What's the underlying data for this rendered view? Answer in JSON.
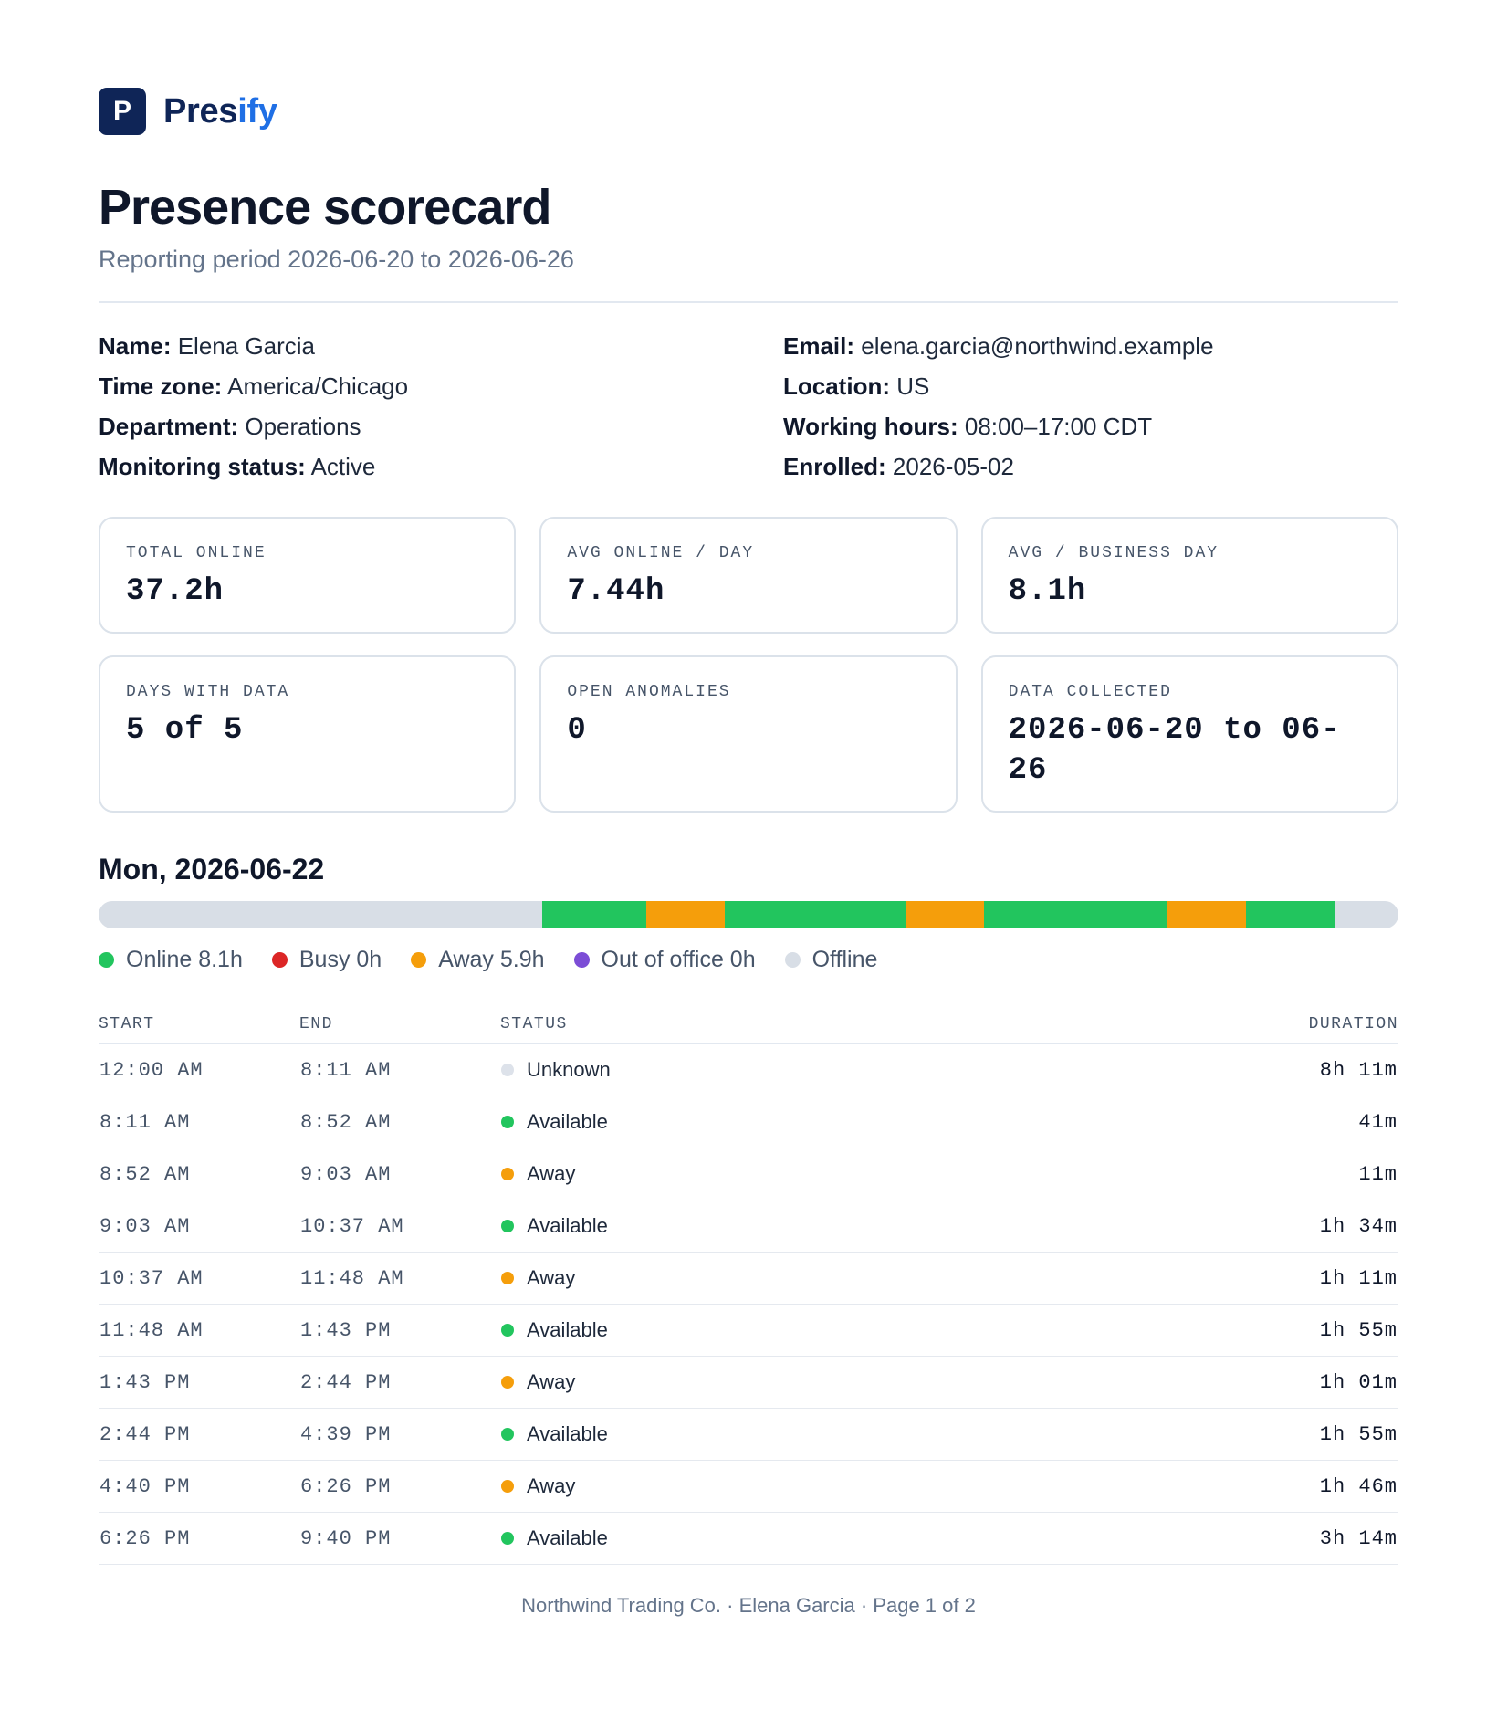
{
  "brand": {
    "logo_letter": "P",
    "name_start": "Pres",
    "name_accent": "ify"
  },
  "header": {
    "title": "Presence scorecard",
    "subtitle": "Reporting period 2026-06-20 to 2026-06-26"
  },
  "info": {
    "name": {
      "label": "Name:",
      "value": "Elena Garcia"
    },
    "email": {
      "label": "Email:",
      "value": "elena.garcia@northwind.example"
    },
    "timezone": {
      "label": "Time zone:",
      "value": "America/Chicago"
    },
    "location": {
      "label": "Location:",
      "value": "US"
    },
    "department": {
      "label": "Department:",
      "value": "Operations"
    },
    "working_hours": {
      "label": "Working hours:",
      "value": "08:00–17:00 CDT"
    },
    "monitoring_status": {
      "label": "Monitoring status:",
      "value": "Active"
    },
    "enrolled": {
      "label": "Enrolled:",
      "value": "2026-05-02"
    }
  },
  "cards": [
    {
      "label": "TOTAL ONLINE",
      "value": "37.2h"
    },
    {
      "label": "AVG ONLINE / DAY",
      "value": "7.44h"
    },
    {
      "label": "AVG / BUSINESS DAY",
      "value": "8.1h"
    },
    {
      "label": "DAYS WITH DATA",
      "value": "5 of 5"
    },
    {
      "label": "OPEN ANOMALIES",
      "value": "0"
    },
    {
      "label": "DATA COLLECTED",
      "value": "2026-06-20 to 06-26"
    }
  ],
  "day": {
    "title": "Mon, 2026-06-22",
    "timeline_hours": 24,
    "timeline_segments": [
      {
        "status": "available",
        "start_h": 8.183,
        "end_h": 10.117
      },
      {
        "status": "away",
        "start_h": 10.117,
        "end_h": 11.567
      },
      {
        "status": "available",
        "start_h": 11.567,
        "end_h": 14.9
      },
      {
        "status": "away",
        "start_h": 14.9,
        "end_h": 16.35
      },
      {
        "status": "available",
        "start_h": 16.35,
        "end_h": 19.733
      },
      {
        "status": "away",
        "start_h": 19.733,
        "end_h": 21.183
      },
      {
        "status": "available",
        "start_h": 21.183,
        "end_h": 22.817
      }
    ],
    "legend": [
      {
        "label": "Online 8.1h",
        "color": "#22c55e"
      },
      {
        "label": "Busy 0h",
        "color": "#dc2626"
      },
      {
        "label": "Away 5.9h",
        "color": "#f59e0b"
      },
      {
        "label": "Out of office 0h",
        "color": "#7c4dd6"
      },
      {
        "label": "Offline",
        "color": "#d8dee6"
      }
    ]
  },
  "table": {
    "headers": {
      "start": "START",
      "end": "END",
      "status": "STATUS",
      "duration": "DURATION"
    },
    "rows": [
      {
        "start": "12:00 AM",
        "end": "8:11 AM",
        "status": "Unknown",
        "duration": "8h 11m"
      },
      {
        "start": "8:11 AM",
        "end": "8:52 AM",
        "status": "Available",
        "duration": "41m"
      },
      {
        "start": "8:52 AM",
        "end": "9:03 AM",
        "status": "Away",
        "duration": "11m"
      },
      {
        "start": "9:03 AM",
        "end": "10:37 AM",
        "status": "Available",
        "duration": "1h 34m"
      },
      {
        "start": "10:37 AM",
        "end": "11:48 AM",
        "status": "Away",
        "duration": "1h 11m"
      },
      {
        "start": "11:48 AM",
        "end": "1:43 PM",
        "status": "Available",
        "duration": "1h 55m"
      },
      {
        "start": "1:43 PM",
        "end": "2:44 PM",
        "status": "Away",
        "duration": "1h 01m"
      },
      {
        "start": "2:44 PM",
        "end": "4:39 PM",
        "status": "Available",
        "duration": "1h 55m"
      },
      {
        "start": "4:40 PM",
        "end": "6:26 PM",
        "status": "Away",
        "duration": "1h 46m"
      },
      {
        "start": "6:26 PM",
        "end": "9:40 PM",
        "status": "Available",
        "duration": "3h 14m"
      }
    ]
  },
  "status_colors": {
    "available": "#22c55e",
    "away": "#f59e0b",
    "unknown": "#dde2ea",
    "busy": "#dc2626",
    "out_of_office": "#7c4dd6"
  },
  "footer": {
    "text": "Northwind Trading Co. · Elena Garcia · Page 1 of 2"
  }
}
